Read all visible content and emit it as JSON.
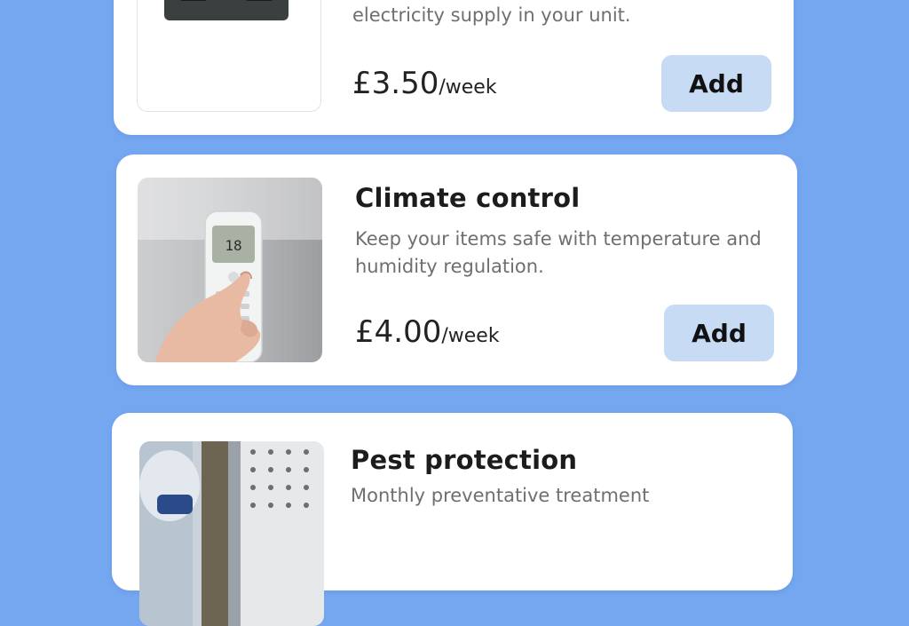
{
  "cards": [
    {
      "desc_line2": "electricity supply in your unit.",
      "price_amount": "£3.50",
      "price_unit": "/week",
      "button": "Add",
      "image_icon": "power-socket"
    },
    {
      "title": "Climate control",
      "desc": "Keep your items safe with temperature and humidity regulation.",
      "price_amount": "£4.00",
      "price_unit": "/week",
      "button": "Add",
      "image_icon": "ac-remote",
      "remote_display": "18"
    },
    {
      "title": "Pest protection",
      "desc": "Monthly preventative treatment",
      "image_icon": "pest-treatment"
    }
  ],
  "colors": {
    "background": "#74a7f0",
    "card": "#ffffff",
    "button": "#c7dbf5"
  }
}
